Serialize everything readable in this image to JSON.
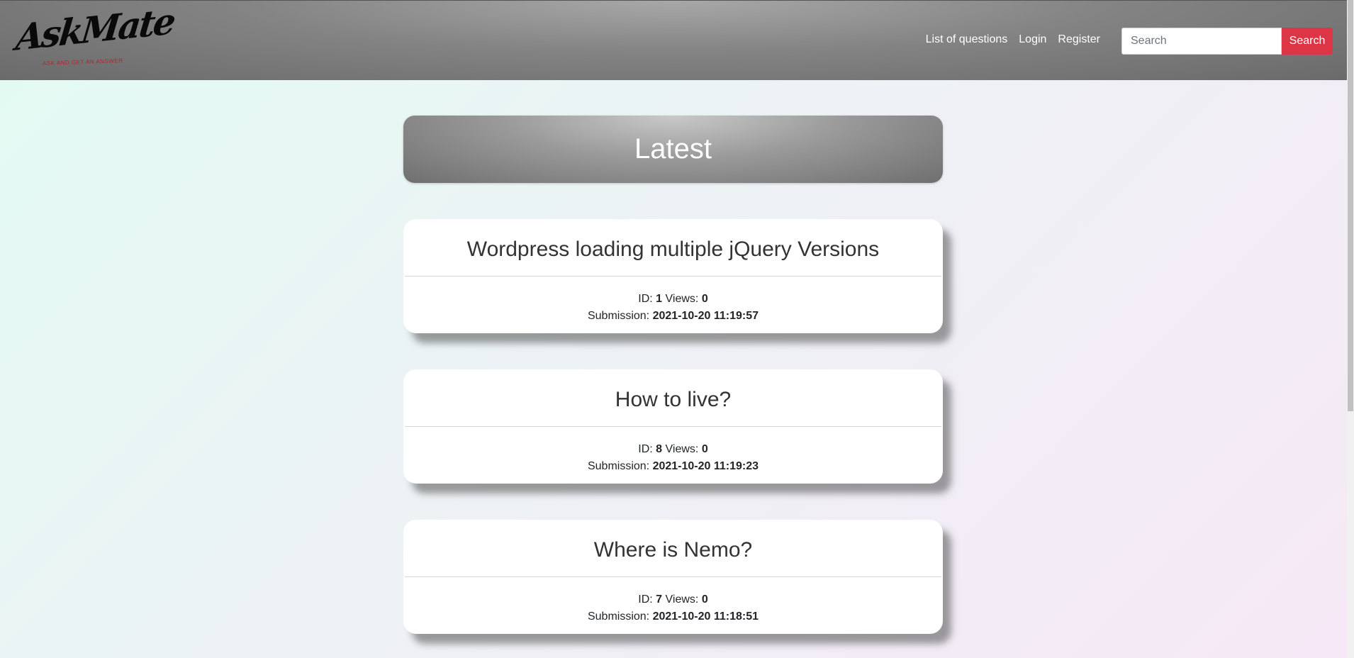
{
  "brand": {
    "logo_text": "AskMate",
    "tagline": "ASK AND GET AN ANSWER"
  },
  "nav": {
    "links": [
      "List of questions",
      "Login",
      "Register"
    ]
  },
  "search": {
    "placeholder": "Search",
    "button_label": "Search",
    "button_color": "#dc3545"
  },
  "latest": {
    "heading": "Latest"
  },
  "labels": {
    "id": "ID:",
    "views": "Views:",
    "submission": "Submission:"
  },
  "questions": [
    {
      "title": "Wordpress loading multiple jQuery Versions",
      "id": "1",
      "views": "0",
      "submission": "2021-10-20 11:19:57"
    },
    {
      "title": "How to live?",
      "id": "8",
      "views": "0",
      "submission": "2021-10-20 11:19:23"
    },
    {
      "title": "Where is Nemo?",
      "id": "7",
      "views": "0",
      "submission": "2021-10-20 11:18:51"
    }
  ]
}
